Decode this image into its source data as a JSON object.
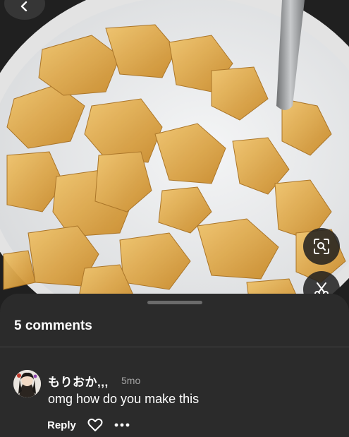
{
  "photo": {
    "alt": "",
    "colors": {
      "milk": "#eef0f1",
      "flake": "#e0a94a",
      "spoon": "#9ea0a2",
      "bowl": "#d9d9d9"
    }
  },
  "icons": {
    "back": "chevron-left-icon",
    "lens": "visual-search-icon",
    "scissors": "scissors-icon",
    "heart": "heart-outline-icon",
    "more": "more-horizontal-icon"
  },
  "sheet": {
    "title": "5 comments"
  },
  "comments": [
    {
      "username": "もりおか,,,",
      "time": "5mo",
      "text": "omg how do you make this",
      "reply_label": "Reply"
    }
  ],
  "theme": {
    "sheet_bg": "#2b2b2b",
    "text": "#ffffff",
    "muted": "#a5a5a5"
  }
}
